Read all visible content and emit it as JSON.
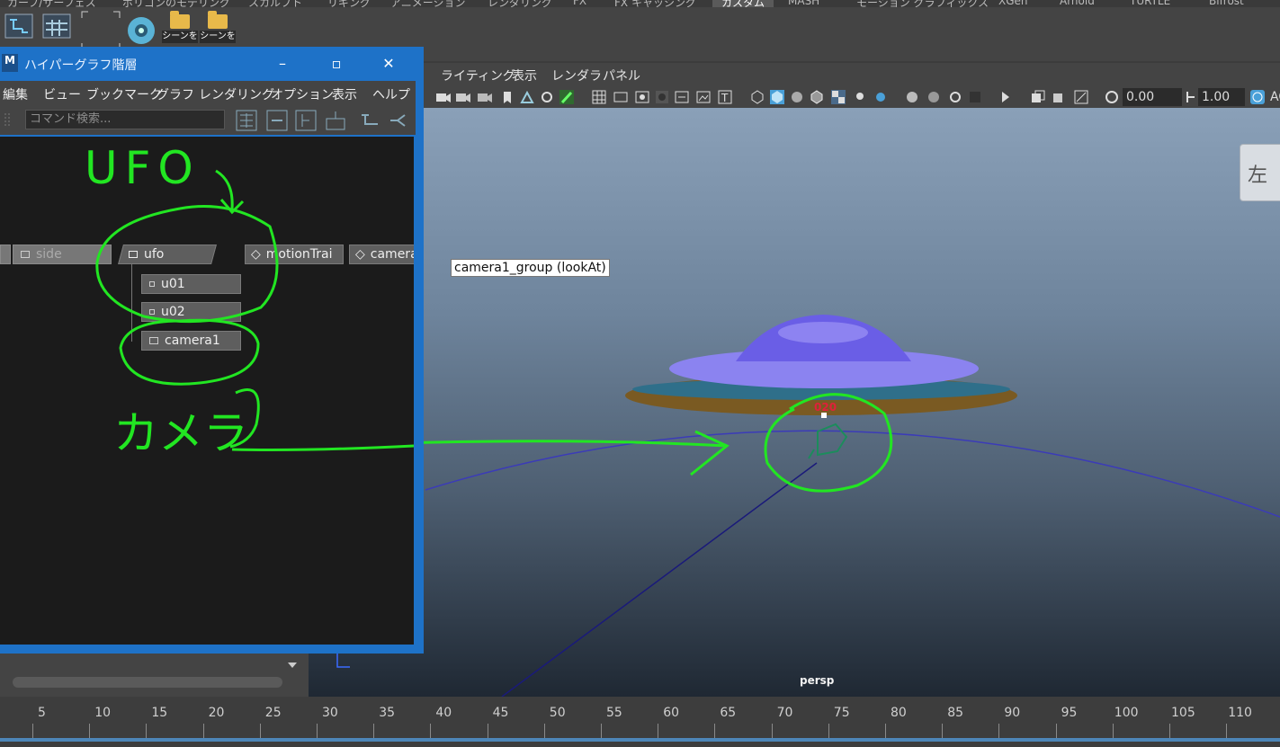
{
  "shelf_tabs": [
    {
      "label": "カーブ/サーフェス"
    },
    {
      "label": "ポリゴンのモデリング"
    },
    {
      "label": "スカルプト"
    },
    {
      "label": "リギング"
    },
    {
      "label": "アニメーション"
    },
    {
      "label": "レンダリング"
    },
    {
      "label": "FX"
    },
    {
      "label": "FX キャッシング"
    },
    {
      "label": "カスタム",
      "active": true
    },
    {
      "label": "MASH"
    },
    {
      "label": "モーション グラフィックス"
    },
    {
      "label": "XGen"
    },
    {
      "label": "Arnold"
    },
    {
      "label": "TURTLE"
    },
    {
      "label": "Bifrost"
    }
  ],
  "shelf": {
    "scene_button_1": "シーンを",
    "scene_button_2": "シーンを"
  },
  "hypergraph": {
    "title": "ハイパーグラフ階層",
    "app_icon": "M",
    "menus": [
      "編集",
      "ビュー",
      "ブックマーク",
      "グラフ",
      "レンダリング",
      "オプション",
      "表示",
      "ヘルプ"
    ],
    "search_placeholder": "コマンド検索...",
    "nodes": {
      "side": "side",
      "ufo": "ufo",
      "motion_trail": "motionTrai",
      "camera_group": "camera",
      "u01": "u01",
      "u02": "u02",
      "camera1": "camera1"
    },
    "annotations": {
      "ufo_note": "UFO",
      "camera_note": "カメラ"
    }
  },
  "viewport": {
    "menus": [
      "ライティング",
      "表示",
      "レンダラ",
      "パネル"
    ],
    "field_1": "0.00",
    "field_2": "1.00",
    "tooltip": "camera1_group (lookAt)",
    "frame_label": "020",
    "camera_name": "persp",
    "viewcube_face": "左"
  },
  "timeline": {
    "ticks": [
      "5",
      "10",
      "15",
      "20",
      "25",
      "30",
      "35",
      "40",
      "45",
      "50",
      "55",
      "60",
      "65",
      "70",
      "75",
      "80",
      "85",
      "90",
      "95",
      "100",
      "105",
      "110"
    ]
  },
  "colors": {
    "title_blue": "#1e72c8",
    "annotation_green": "#22e622",
    "ufo_dome": "#7c6cf0",
    "ufo_disc": "#8a6a2a"
  }
}
